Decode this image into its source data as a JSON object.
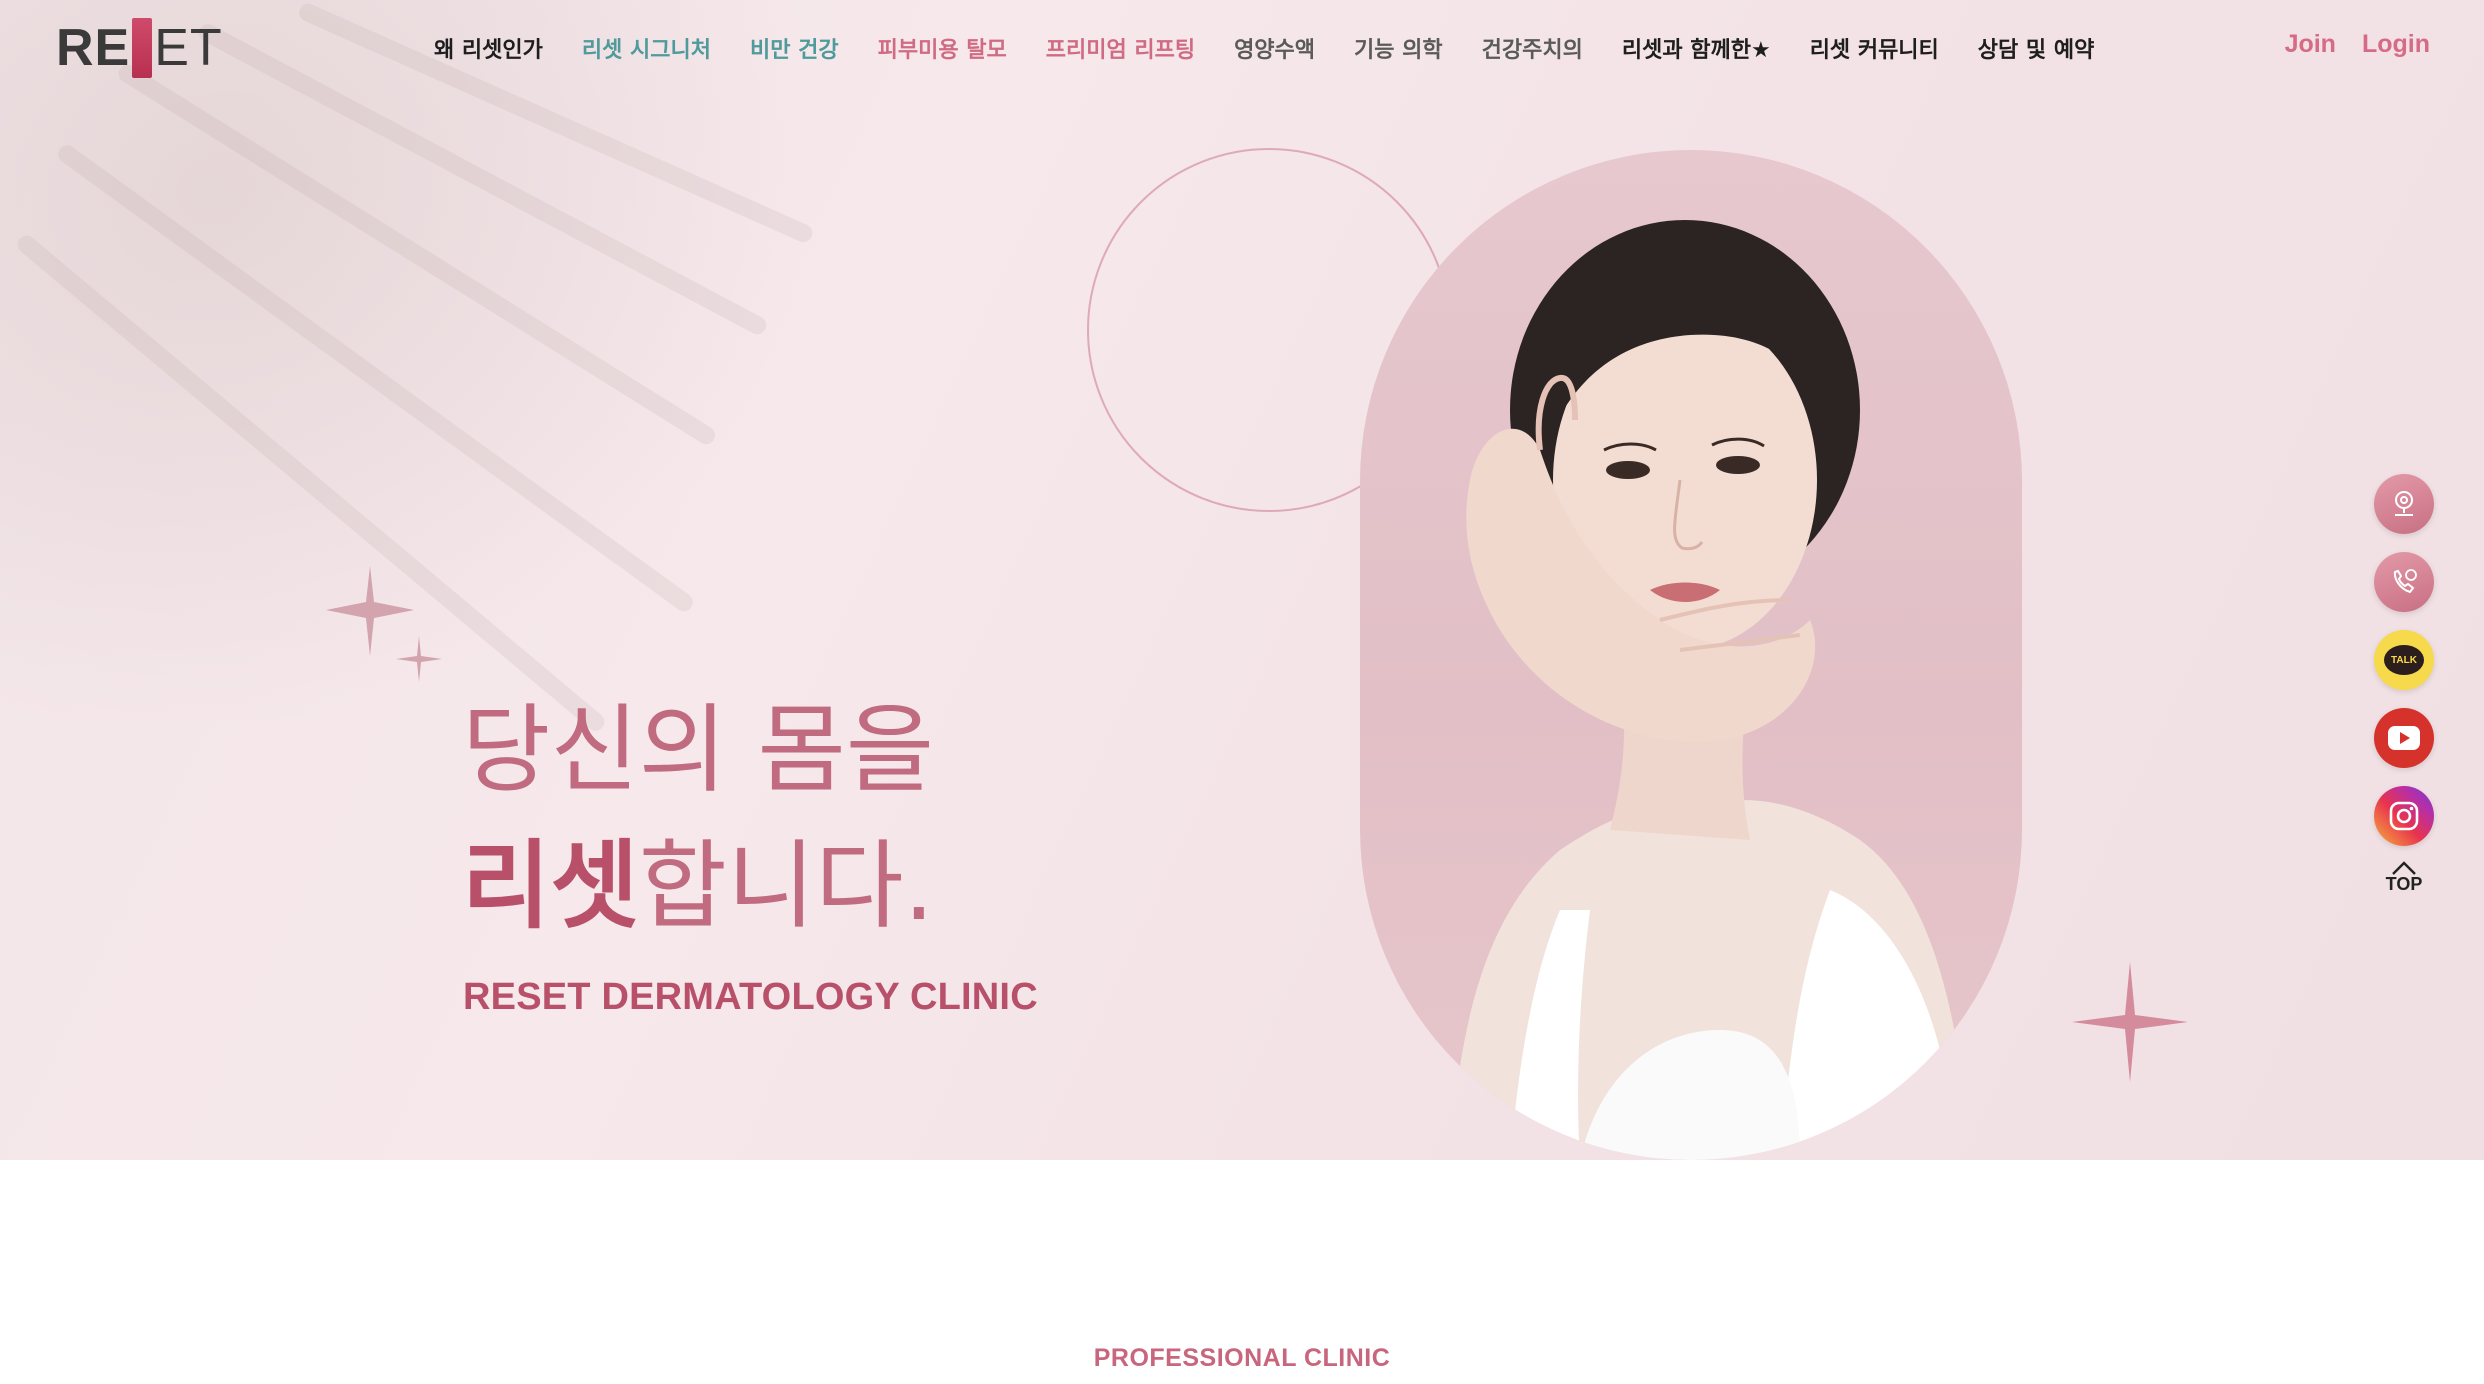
{
  "brand": {
    "logo_prefix": "RE",
    "logo_mark": "S",
    "logo_suffix": "ET",
    "accent_color": "#cf6b82",
    "teal_color": "#4f9a9a"
  },
  "nav": {
    "items": [
      {
        "label": "왜 리셋인가",
        "tone": "dark"
      },
      {
        "label": "리셋 시그니처",
        "tone": "teal"
      },
      {
        "label": "비만 건강",
        "tone": "teal"
      },
      {
        "label": "피부미용 탈모",
        "tone": "pink"
      },
      {
        "label": "프리미엄 리프팅",
        "tone": "pink"
      },
      {
        "label": "영양수액",
        "tone": "gray"
      },
      {
        "label": "기능 의학",
        "tone": "gray"
      },
      {
        "label": "건강주치의",
        "tone": "gray"
      },
      {
        "label": "리셋과 함께한★",
        "tone": "dark"
      },
      {
        "label": "리셋 커뮤니티",
        "tone": "dark"
      },
      {
        "label": "상담 및 예약",
        "tone": "dark"
      }
    ]
  },
  "auth": {
    "join_label": "Join",
    "login_label": "Login"
  },
  "hero": {
    "headline_line1": "당신의 몸을",
    "headline_emphasis": "리셋",
    "headline_line2_rest": "합니다.",
    "clinic_name": "RESET DERMATOLOGY CLINIC"
  },
  "quick_menu": {
    "items": [
      {
        "icon": "location-pin-icon"
      },
      {
        "icon": "phone-icon"
      },
      {
        "icon": "kakao-talk-icon",
        "text": "TALK"
      },
      {
        "icon": "youtube-icon"
      },
      {
        "icon": "instagram-icon"
      }
    ],
    "top_label": "TOP"
  },
  "section": {
    "label": "PROFESSIONAL CLINIC"
  }
}
